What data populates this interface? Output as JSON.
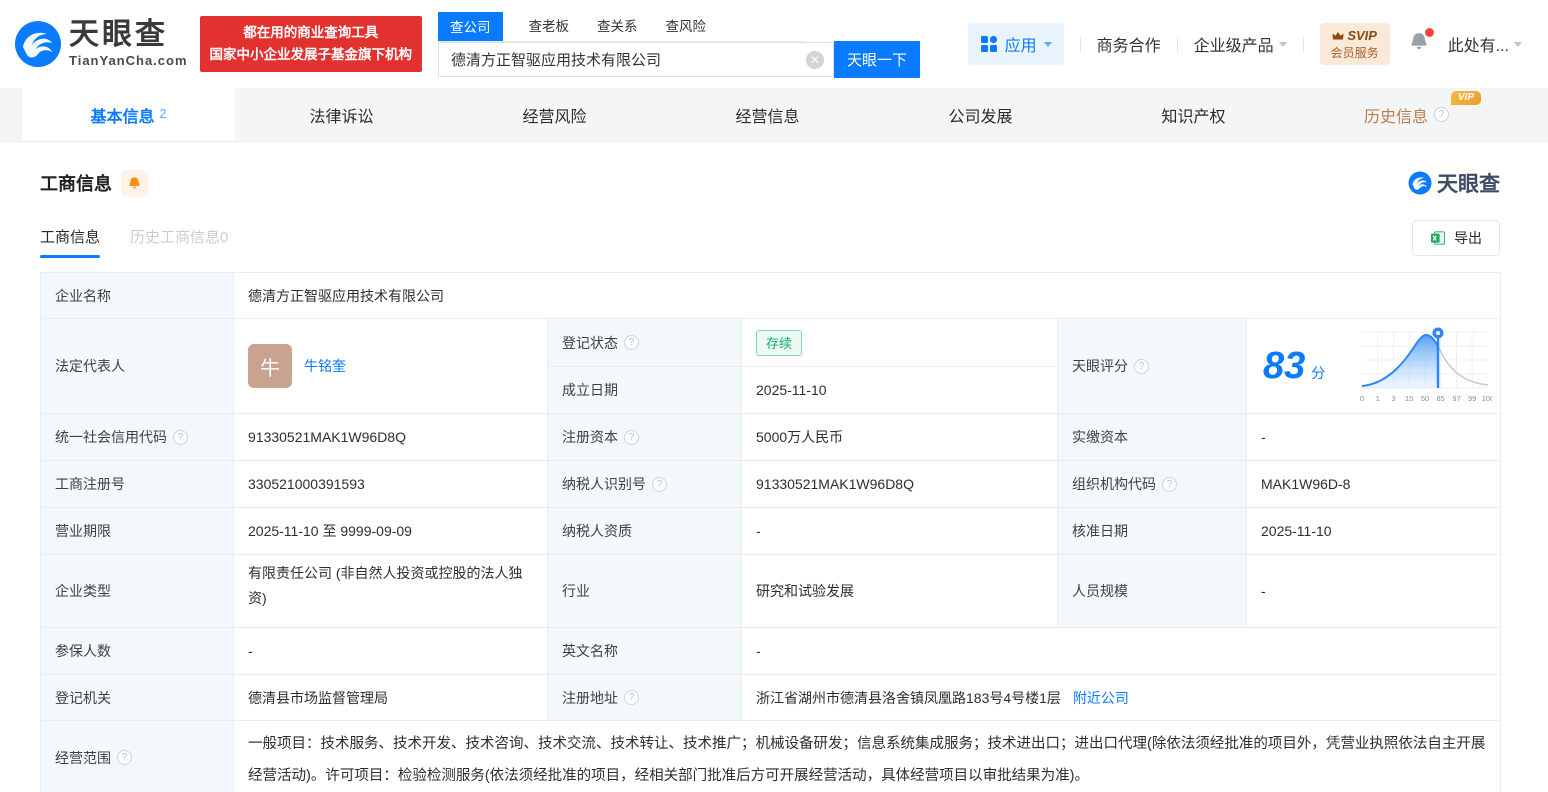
{
  "colors": {
    "accent": "#0a7bff",
    "brand_red": "#e23230",
    "status_green": "#0cb268",
    "vip_orange": "#ef9b2c",
    "label_bg": "#f2f8fc",
    "score_blue": "#0a7bff"
  },
  "header": {
    "brand": "天眼查",
    "brand_domain": "TianYanCha.com",
    "slogan_line1": "都在用的商业查询工具",
    "slogan_line2": "国家中小企业发展子基金旗下机构",
    "search_tabs": [
      {
        "label": "查公司",
        "active": true
      },
      {
        "label": "查老板",
        "active": false
      },
      {
        "label": "查关系",
        "active": false
      },
      {
        "label": "查风险",
        "active": false
      }
    ],
    "search_value": "德清方正智驱应用技术有限公司",
    "search_button": "天眼一下",
    "nav_apps": "应用",
    "nav_cooperation": "商务合作",
    "nav_enterprise": "企业级产品",
    "svip_line1": "SVIP",
    "svip_line2": "会员服务",
    "user_name": "此处有..."
  },
  "main_tabs": [
    {
      "label": "基本信息",
      "count": "2"
    },
    {
      "label": "法律诉讼"
    },
    {
      "label": "经营风险"
    },
    {
      "label": "经营信息"
    },
    {
      "label": "公司发展"
    },
    {
      "label": "知识产权"
    },
    {
      "label": "历史信息",
      "vip": "VIP"
    }
  ],
  "section": {
    "title": "工商信息",
    "watermark": "天眼查",
    "subtab_active": "工商信息",
    "subtab_history": "历史工商信息0",
    "export_label": "导出"
  },
  "table": {
    "company_name": {
      "label": "企业名称",
      "value": "德清方正智驱应用技术有限公司"
    },
    "legal_rep": {
      "label": "法定代表人",
      "avatar": "牛",
      "name": "牛铭奎"
    },
    "reg_status": {
      "label": "登记状态",
      "value": "存续"
    },
    "establish_date": {
      "label": "成立日期",
      "value": "2025-11-10"
    },
    "tyc_score": {
      "label": "天眼评分",
      "score": "83",
      "unit": "分"
    },
    "credit_code": {
      "label": "统一社会信用代码",
      "value": "91330521MAK1W96D8Q"
    },
    "reg_capital": {
      "label": "注册资本",
      "value": "5000万人民币"
    },
    "paid_capital": {
      "label": "实缴资本",
      "value": "-"
    },
    "reg_number": {
      "label": "工商注册号",
      "value": "330521000391593"
    },
    "taxpayer_id": {
      "label": "纳税人识别号",
      "value": "91330521MAK1W96D8Q"
    },
    "org_code": {
      "label": "组织机构代码",
      "value": "MAK1W96D-8"
    },
    "business_term": {
      "label": "营业期限",
      "value": "2025-11-10 至 9999-09-09"
    },
    "taxpayer_quality": {
      "label": "纳税人资质",
      "value": "-"
    },
    "approval_date": {
      "label": "核准日期",
      "value": "2025-11-10"
    },
    "company_type": {
      "label": "企业类型",
      "value": "有限责任公司 (非自然人投资或控股的法人独资)"
    },
    "industry": {
      "label": "行业",
      "value": "研究和试验发展"
    },
    "staff_size": {
      "label": "人员规模",
      "value": "-"
    },
    "insured_count": {
      "label": "参保人数",
      "value": "-"
    },
    "english_name": {
      "label": "英文名称",
      "value": "-"
    },
    "reg_authority": {
      "label": "登记机关",
      "value": "德清县市场监督管理局"
    },
    "reg_address": {
      "label": "注册地址",
      "value": "浙江省湖州市德清县洛舍镇凤凰路183号4号楼1层",
      "link": "附近公司"
    },
    "business_scope": {
      "label": "经营范围",
      "value": "一般项目：技术服务、技术开发、技术咨询、技术交流、技术转让、技术推广；机械设备研发；信息系统集成服务；技术进出口；进出口代理(除依法须经批准的项目外，凭营业执照依法自主开展经营活动)。许可项目：检验检测服务(依法须经批准的项目，经相关部门批准后方可开展经营活动，具体经营项目以审批结果为准)。"
    }
  },
  "chart_data": {
    "type": "area",
    "title": "天眼评分",
    "score": 83,
    "unit": "分",
    "curve": "bell-percentile",
    "x_ticks": [
      "0",
      "1",
      "3",
      "15",
      "50",
      "85",
      "97",
      "99",
      "100"
    ],
    "marker_value": 83,
    "fill_color": "#4d9af3",
    "rest_color": "#c5cdd8",
    "grid": true
  }
}
